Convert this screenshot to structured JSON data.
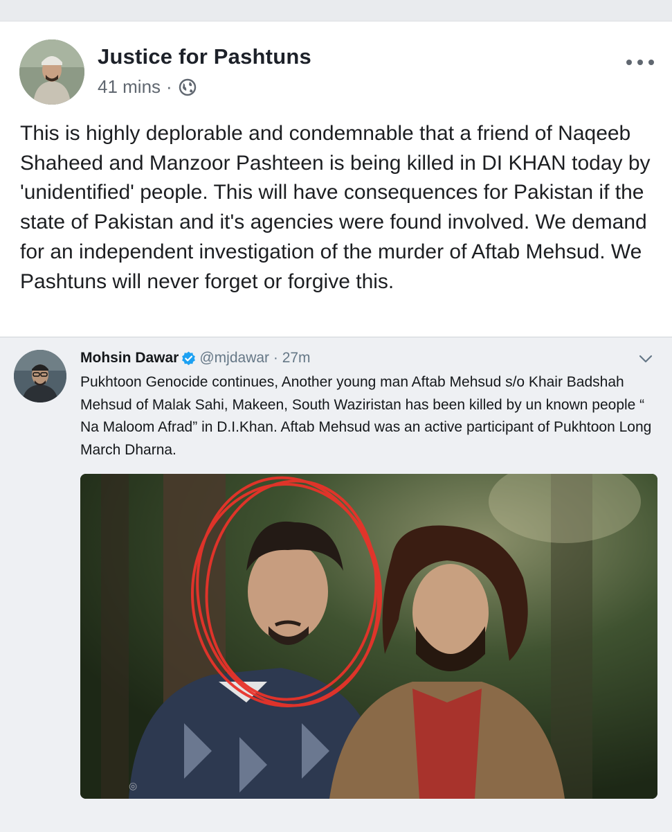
{
  "post": {
    "page_name": "Justice for Pashtuns",
    "timestamp": "41 mins",
    "separator": "·",
    "privacy_icon": "globe-icon",
    "more_icon": "more-horizontal-icon",
    "text": "This is highly deplorable and condemnable that a friend of Naqeeb Shaheed and Manzoor Pashteen is being killed in DI KHAN today by 'unidentified' people. This will have consequences for Pakistan if the state of Pakistan and it's agencies were found involved. We demand for an independent investigation of the murder of Aftab Mehsud. We Pashtuns will never forget or forgive this."
  },
  "tweet": {
    "author_name": "Mohsin Dawar",
    "verified_icon": "verified-badge-icon",
    "handle_time": "@mjdawar · 27m",
    "menu_icon": "chevron-down-icon",
    "text": "Pukhtoon Genocide continues, Another young man Aftab Mehsud s/o Khair Badshah Mehsud of Malak Sahi, Makeen, South Waziristan has been killed by un known people “ Na Maloom Afrad” in D.I.Khan. Aftab Mehsud was an active participant of Pukhtoon Long March Dharna."
  },
  "colors": {
    "feed_bg": "#e9ebee",
    "tweet_bg": "#eef0f3",
    "verified": "#1da1f2",
    "annotation_circle": "#e8332a"
  }
}
